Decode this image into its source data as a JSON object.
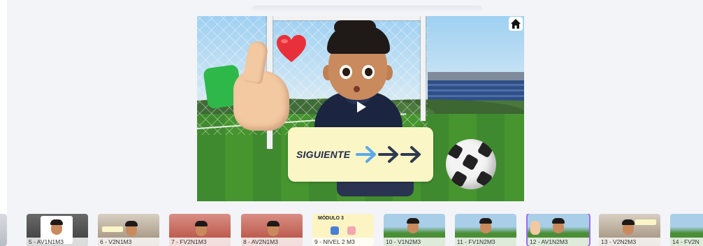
{
  "slide": {
    "next_label": "SIGUIENTE",
    "icons": {
      "home": "home-icon",
      "play": "play-icon",
      "arrows": "arrow-right-icon",
      "heart": "heart-icon",
      "thumbs_up": "thumbs-up-icon"
    },
    "colors": {
      "next_bg": "#fbf6c6",
      "arrow_light": "#5aa9ea",
      "arrow_dark": "#2f3a4f",
      "active_outline": "#9b6cf0"
    }
  },
  "thumbnails": [
    {
      "caption": "",
      "partial": true
    },
    {
      "caption": "5 - AV1N1M3"
    },
    {
      "caption": "6 - V2N1M3"
    },
    {
      "caption": "7 - FV2N1M3"
    },
    {
      "caption": "8 - AV2N1M3"
    },
    {
      "caption": "9 - NIVEL 2 M3",
      "heading": "MÓDULO 3"
    },
    {
      "caption": "10 - V1N2M3"
    },
    {
      "caption": "11 - FV1N2M3"
    },
    {
      "caption": "12 - AV1N2M3",
      "active": true
    },
    {
      "caption": "13 - V2N2M3"
    },
    {
      "caption": "14 - FV2N",
      "partial": true
    }
  ]
}
